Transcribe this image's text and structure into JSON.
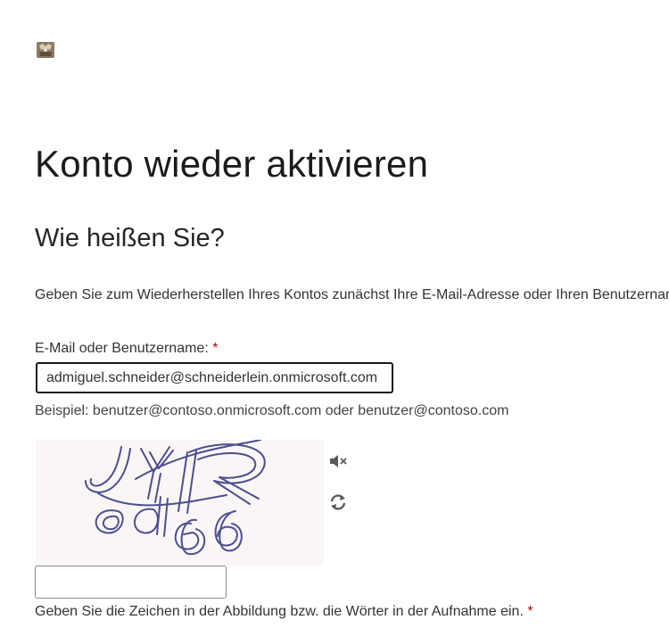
{
  "page": {
    "title": "Konto wieder aktivieren",
    "subtitle": "Wie heißen Sie?",
    "intro": "Geben Sie zum Wiederherstellen Ihres Kontos zunächst Ihre E-Mail-Adresse oder Ihren Benutzernamen ein."
  },
  "email": {
    "label": "E-Mail oder Benutzername:",
    "required_mark": "*",
    "value": "admiguel.schneider@schneiderlein.onmicrosoft.com",
    "hint": "Beispiel: benutzer@contoso.onmicrosoft.com oder benutzer@contoso.com"
  },
  "captcha": {
    "text": "JYR dG6",
    "input_value": "",
    "label": "Geben Sie die Zeichen in der Abbildung bzw. die Wörter in der Aufnahme ein.",
    "required_mark": "*",
    "audio_icon": "speaker-icon",
    "refresh_icon": "refresh-icon"
  },
  "colors": {
    "required": "#c00000",
    "captcha_ink": "#4a4f8f",
    "captcha_bg": "#fbf6f6"
  }
}
